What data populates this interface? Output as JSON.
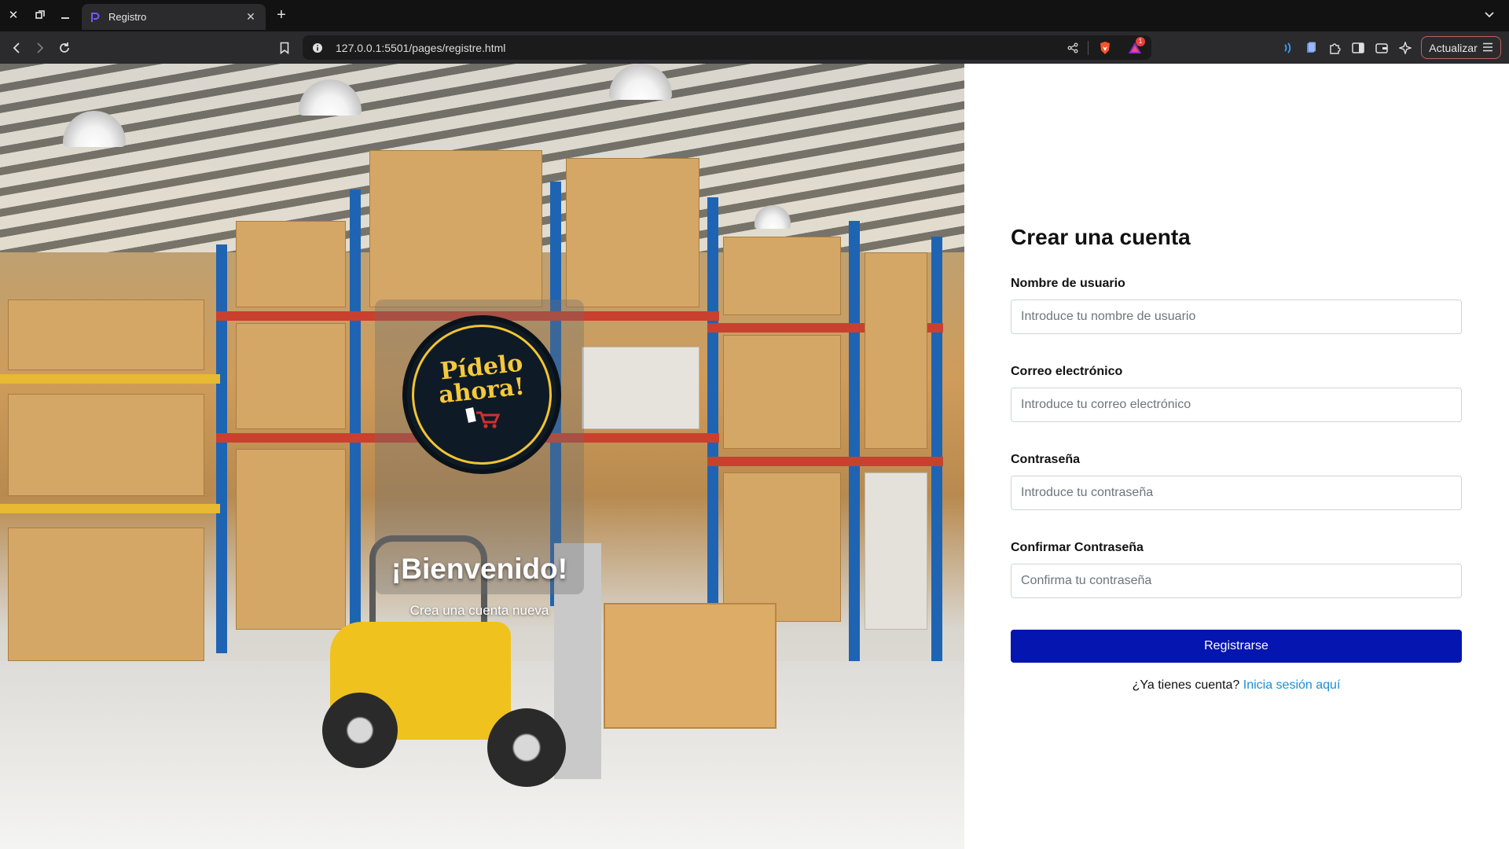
{
  "browser": {
    "tab_title": "Registro",
    "url": "127.0.0.1:5501/pages/registre.html",
    "update_label": "Actualizar",
    "notification_count": "1"
  },
  "hero": {
    "logo_line1": "Pídelo",
    "logo_line2": "ahora!",
    "title": "¡Bienvenido!",
    "subtitle": "Crea una cuenta nueva"
  },
  "form": {
    "title": "Crear una cuenta",
    "fields": [
      {
        "label": "Nombre de usuario",
        "placeholder": "Introduce tu nombre de usuario"
      },
      {
        "label": "Correo electrónico",
        "placeholder": "Introduce tu correo electrónico"
      },
      {
        "label": "Contraseña",
        "placeholder": "Introduce tu contraseña"
      },
      {
        "label": "Confirmar Contraseña",
        "placeholder": "Confirma tu contraseña"
      }
    ],
    "submit_label": "Registrarse",
    "login_prompt": "¿Ya tienes cuenta?",
    "login_link": "Inicia sesión aquí"
  },
  "colors": {
    "primary_button": "#0515b0",
    "link": "#1a8fd6",
    "logo_yellow": "#f6c83a"
  },
  "icons": [
    "close-window-icon",
    "restore-window-icon",
    "minimize-window-icon",
    "tab-favicon-icon",
    "tab-close-icon",
    "new-tab-icon",
    "tab-list-icon",
    "back-icon",
    "forward-icon",
    "reload-icon",
    "bookmark-icon",
    "site-info-icon",
    "share-icon",
    "brave-shields-icon",
    "brave-rewards-icon",
    "extension-wifi-icon",
    "extension-doc-icon",
    "extensions-puzzle-icon",
    "sidebar-icon",
    "wallet-icon",
    "leo-ai-icon",
    "menu-icon"
  ]
}
